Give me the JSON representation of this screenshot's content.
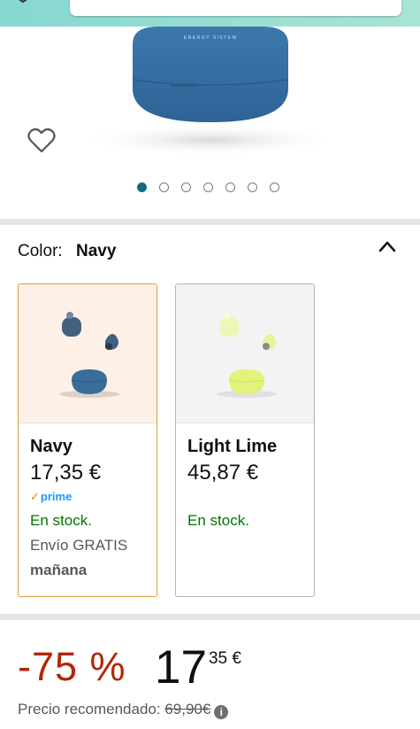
{
  "product": {
    "brand_logo_text": "ENERGY SISTEM"
  },
  "gallery": {
    "image_count": 7,
    "active_index": 0
  },
  "color_selector": {
    "label": "Color:",
    "selected": "Navy",
    "options": [
      {
        "name": "Navy",
        "price": "17,35 €",
        "prime_badge": "prime",
        "stock": "En stock.",
        "shipping": "Envío GRATIS",
        "delivery": "mañana",
        "swatch": "#3a6d9a",
        "selected": true
      },
      {
        "name": "Light Lime",
        "price": "45,87 €",
        "stock": "En stock.",
        "swatch": "#e3f27a",
        "selected": false
      }
    ]
  },
  "pricing": {
    "discount": "-75 %",
    "price_whole": "17",
    "price_fraction": "35 €",
    "list_price_label": "Precio recomendado:",
    "list_price": "69,90€"
  },
  "colors": {
    "accent": "#0f6c7f",
    "deal_red": "#b12704",
    "stock_green": "#007600",
    "selected_border": "#e09b3d"
  }
}
